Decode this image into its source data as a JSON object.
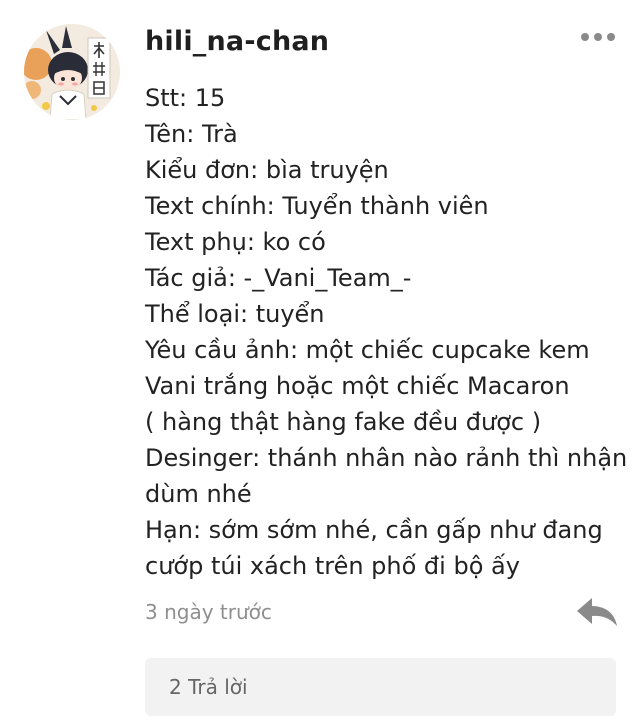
{
  "comment": {
    "username": "hili_na-chan",
    "avatar_icon": "anime-character-avatar",
    "more_icon": "more-options-icon",
    "lines": [
      "Stt: 15",
      "Tên: Trà",
      "Kiểu đơn: bìa truyện",
      "Text chính: Tuyển thành viên",
      "Text phụ: ko có",
      "Tác giả: -_Vani_Team_-",
      "Thể loại: tuyển",
      "Yêu cầu ảnh: một chiếc cupcake kem",
      "Vani trắng hoặc một chiếc Macaron",
      "( hàng thật hàng fake đều được )",
      "Desinger: thánh nhân nào rảnh thì nhận",
      "dùm nhé",
      "Hạn: sớm sớm nhé, cần gấp như đang",
      "cướp túi xách trên phố đi bộ ấy"
    ],
    "timestamp": "3 ngày trước",
    "reply_icon": "reply-arrow-icon",
    "replies_label": "2 Trả lời"
  },
  "colors": {
    "text": "#222222",
    "muted": "#8f8f8f",
    "icon": "#8a8a8a",
    "reply_box_bg": "#f2f2f2"
  }
}
